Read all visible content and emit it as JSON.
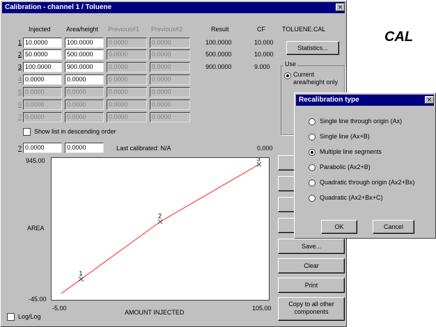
{
  "window": {
    "title": "Calibration - channel 1 / Toluene",
    "close_glyph": "×"
  },
  "headers": {
    "injected": "Injected",
    "area_height": "Area/height",
    "previous1": "Previous#1",
    "previous2": "Previous#2",
    "result": "Result",
    "cf": "CF",
    "file": "TOLUENE.CAL"
  },
  "rows": [
    {
      "num": "1",
      "injected": "10.0000",
      "area": "100.0000",
      "prev1": "0.0000",
      "prev2": "0.0000",
      "result": "100.0000",
      "cf": "10.000"
    },
    {
      "num": "2",
      "injected": "50.0000",
      "area": "500.0000",
      "prev1": "0.0000",
      "prev2": "0.0000",
      "result": "500.0000",
      "cf": "10.000"
    },
    {
      "num": "3",
      "injected": "100.0000",
      "area": "900.0000",
      "prev1": "0.0000",
      "prev2": "0.0000",
      "result": "900.0000",
      "cf": "9.000"
    },
    {
      "num": "4",
      "injected": "0.0000",
      "area": "0.0000",
      "prev1": "0.0000",
      "prev2": "0.0000",
      "result": "",
      "cf": ""
    },
    {
      "num": "5",
      "injected": "0.0000",
      "area": "0.0000",
      "prev1": "0.0000",
      "prev2": "0.0000",
      "result": "",
      "cf": ""
    },
    {
      "num": "6",
      "injected": "0.0000",
      "area": "0.0000",
      "prev1": "0.0000",
      "prev2": "0.0000",
      "result": "",
      "cf": ""
    },
    {
      "num": "7",
      "injected": "0.0000",
      "area": "0.0000",
      "prev1": "0.0000",
      "prev2": "0.0000",
      "result": "",
      "cf": ""
    }
  ],
  "statistics_button": "Statistics...",
  "use_group": {
    "label": "Use",
    "current_option": "Current area/height only"
  },
  "show_desc_checkbox": "Show list in descending order",
  "query_row": {
    "num": "?",
    "injected": "0.0000",
    "area": "0.0000",
    "last_calibrated": "Last calibrated:  N/A",
    "result": "0.000"
  },
  "chart": {
    "ylabel": "AREA",
    "xlabel": "AMOUNT INJECTED",
    "y_max_label": "945.00",
    "y_min_label": "-45.00",
    "x_min_label": "-5.00",
    "x_max_label": "105.00"
  },
  "chart_data": {
    "type": "line",
    "x": [
      10,
      50,
      100
    ],
    "y": [
      100,
      500,
      900
    ],
    "point_labels": [
      "1",
      "2",
      "3"
    ],
    "xlabel": "AMOUNT INJECTED",
    "ylabel": "AREA",
    "xlim": [
      -5,
      105
    ],
    "ylim": [
      -45,
      945
    ],
    "line_color": "#ff6060",
    "grid": false
  },
  "buttons": {
    "save": "Save...",
    "clear": "Clear",
    "print": "Print",
    "copy_line1": "Copy to all other",
    "copy_line2": "components"
  },
  "loglog_checkbox": "Log/Log",
  "side_label": "CAL",
  "recal_dialog": {
    "title": "Recalibration type",
    "options": [
      "Single line through origin (Ax)",
      "Single line (Ax+B)",
      "Multiple line segments",
      "Parabolic (Ax2+B)",
      "Quadratic through origin (Ax2+Bx)",
      "Quadratic (Ax2+Bx+C)"
    ],
    "selected_index": 2,
    "ok": "OK",
    "cancel": "Cancel"
  },
  "colors": {
    "titlebar": "#000080",
    "face": "#c0c0c0",
    "plot_line": "#ff6060"
  }
}
